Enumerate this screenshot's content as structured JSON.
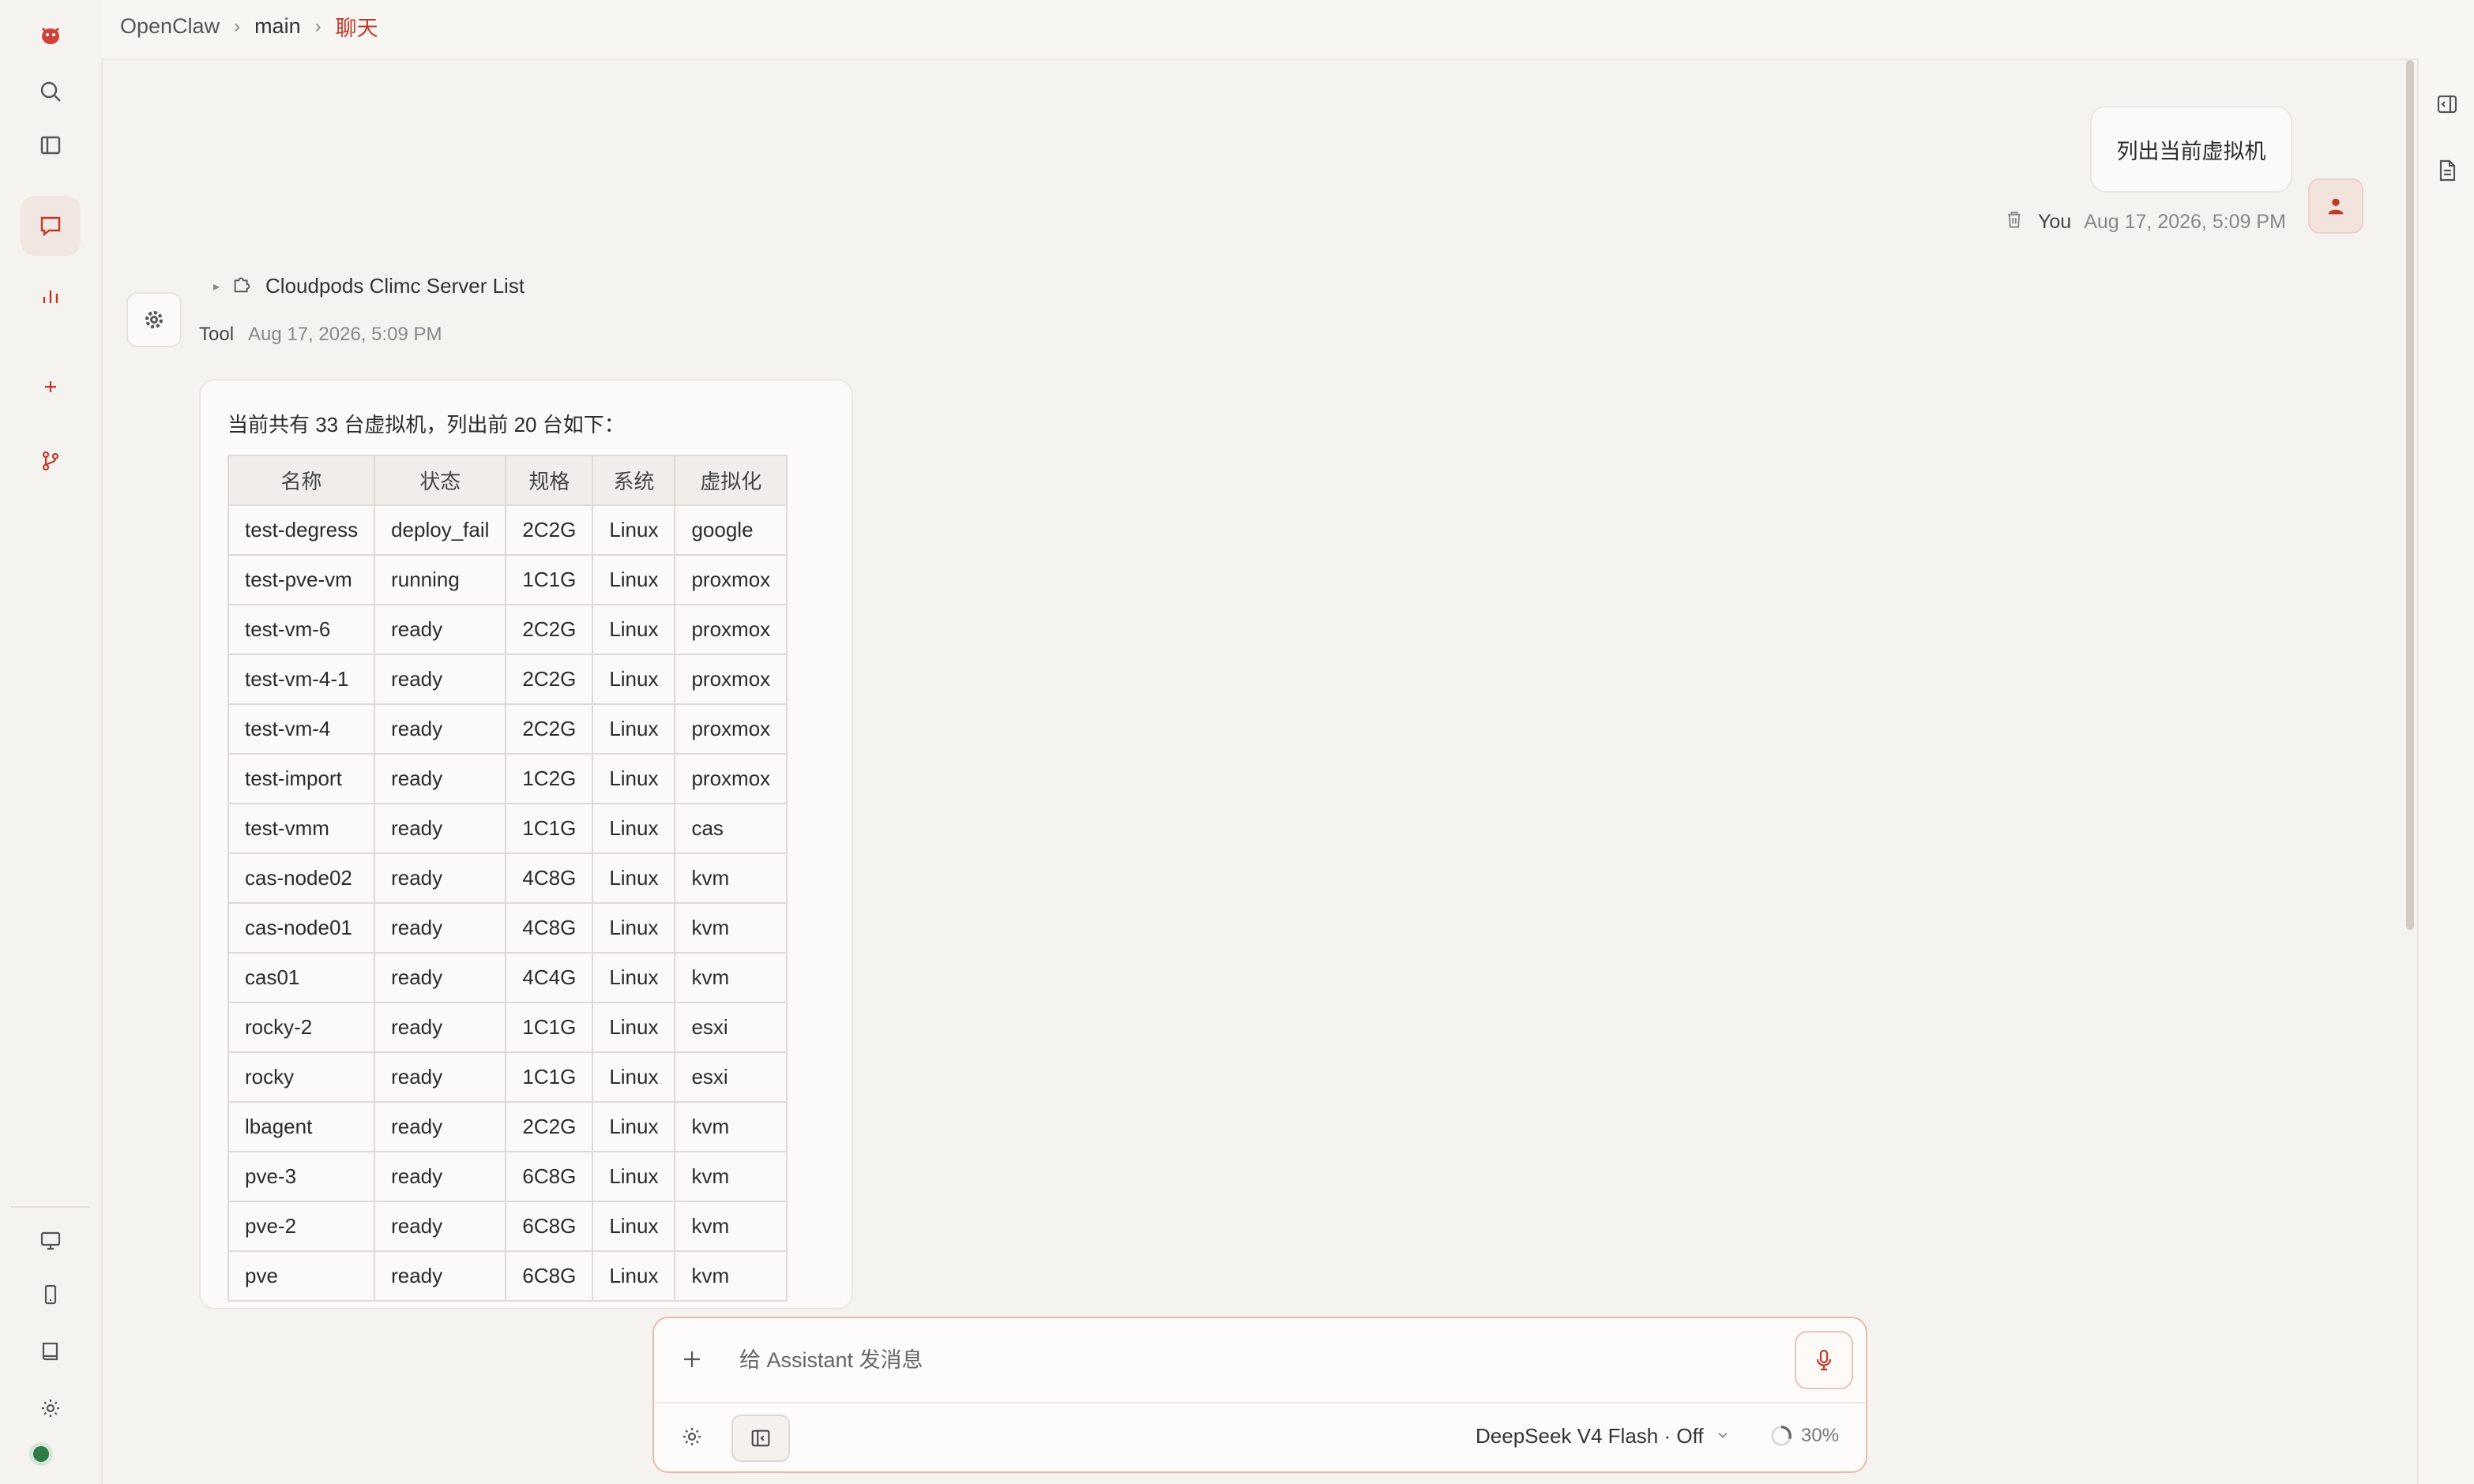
{
  "breadcrumb": {
    "root": "OpenClaw",
    "agent": "main",
    "current": "聊天"
  },
  "user_message": {
    "text": "列出当前虚拟机",
    "author": "You",
    "timestamp": "Aug 17, 2026, 5:09 PM"
  },
  "tool_message": {
    "tool_name": "Cloudpods Climc Server List",
    "author": "Tool",
    "timestamp": "Aug 17, 2026, 5:09 PM",
    "intro": "当前共有 33 台虚拟机，列出前 20 台如下：",
    "columns": [
      "名称",
      "状态",
      "规格",
      "系统",
      "虚拟化"
    ],
    "rows": [
      [
        "test-degress",
        "deploy_fail",
        "2C2G",
        "Linux",
        "google"
      ],
      [
        "test-pve-vm",
        "running",
        "1C1G",
        "Linux",
        "proxmox"
      ],
      [
        "test-vm-6",
        "ready",
        "2C2G",
        "Linux",
        "proxmox"
      ],
      [
        "test-vm-4-1",
        "ready",
        "2C2G",
        "Linux",
        "proxmox"
      ],
      [
        "test-vm-4",
        "ready",
        "2C2G",
        "Linux",
        "proxmox"
      ],
      [
        "test-import",
        "ready",
        "1C2G",
        "Linux",
        "proxmox"
      ],
      [
        "test-vmm",
        "ready",
        "1C1G",
        "Linux",
        "cas"
      ],
      [
        "cas-node02",
        "ready",
        "4C8G",
        "Linux",
        "kvm"
      ],
      [
        "cas-node01",
        "ready",
        "4C8G",
        "Linux",
        "kvm"
      ],
      [
        "cas01",
        "ready",
        "4C4G",
        "Linux",
        "kvm"
      ],
      [
        "rocky-2",
        "ready",
        "1C1G",
        "Linux",
        "esxi"
      ],
      [
        "rocky",
        "ready",
        "1C1G",
        "Linux",
        "esxi"
      ],
      [
        "lbagent",
        "ready",
        "2C2G",
        "Linux",
        "kvm"
      ],
      [
        "pve-3",
        "ready",
        "6C8G",
        "Linux",
        "kvm"
      ],
      [
        "pve-2",
        "ready",
        "6C8G",
        "Linux",
        "kvm"
      ],
      [
        "pve",
        "ready",
        "6C8G",
        "Linux",
        "kvm"
      ]
    ]
  },
  "composer": {
    "placeholder": "给 Assistant 发消息",
    "model": "DeepSeek V4 Flash · Off",
    "context_usage": "30%"
  },
  "colors": {
    "accent": "#c0392b",
    "status_online": "#2f7a45"
  }
}
